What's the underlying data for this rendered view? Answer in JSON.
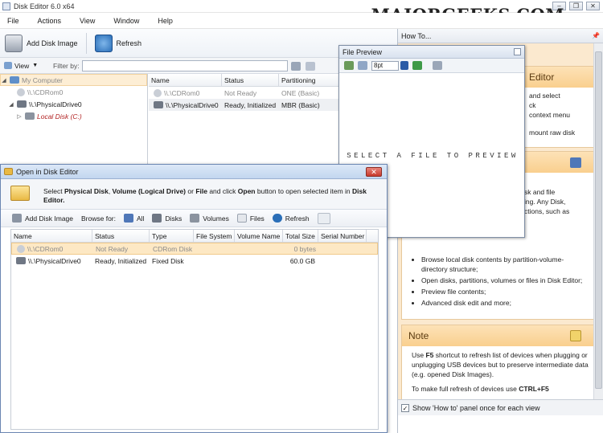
{
  "window": {
    "title": "Disk Editor 6.0 x64",
    "watermark": "MAJORGEEKS.COM",
    "controls": [
      "–",
      "❐",
      "✕"
    ]
  },
  "menu": [
    "File",
    "Actions",
    "View",
    "Window",
    "Help"
  ],
  "toolbar": {
    "add_disk_image": "Add Disk Image",
    "refresh": "Refresh"
  },
  "filterbar": {
    "view_label": "View",
    "filter_label": "Filter by:",
    "filter_value": ""
  },
  "tree": {
    "root": "My Computer",
    "items": [
      {
        "label": "\\\\.\\CDRom0"
      },
      {
        "label": "\\\\.\\PhysicalDrive0"
      },
      {
        "label": "Local Disk (C:)"
      }
    ]
  },
  "grid": {
    "columns": [
      "Name",
      "Status",
      "Partitioning"
    ],
    "rows": [
      {
        "name": "\\\\.\\CDRom0",
        "status": "Not Ready",
        "partitioning": "ONE (Basic)"
      },
      {
        "name": "\\\\.\\PhysicalDrive0",
        "status": "Ready, Initialized",
        "partitioning": "MBR (Basic)"
      }
    ]
  },
  "preview": {
    "title": "File Preview",
    "font_size": "8pt",
    "message": "SELECT A FILE TO PREVIEW"
  },
  "howto": {
    "title": "How To...",
    "section1_heading": "Editor",
    "section1_lines": [
      "and select",
      "ck",
      "context menu",
      "mount raw disk"
    ],
    "section2_lines": [
      "sk and file",
      "ing. Any Disk,",
      "ctions, such as"
    ],
    "bullets": [
      "Browse local disk contents by partition-volume-directory structure;",
      "Open disks, partitions, volumes or files in Disk Editor;",
      "Preview file contents;",
      "Advanced disk edit and more;"
    ],
    "note_heading": "Note",
    "note_p1_pre": "Use ",
    "note_p1_key": "F5",
    "note_p1_post": " shortcut to refresh list of devices when plugging or unplugging USB devices but to preserve intermediate data (e.g. opened Disk Images).",
    "note_p2_pre": "To make full refresh of devices use ",
    "note_p2_key": "CTRL+F5",
    "footer_checkbox": "Show 'How to' panel once for each view"
  },
  "dialog": {
    "title": "Open in Disk Editor",
    "instr_1": "Select ",
    "instr_b1": "Physical Disk",
    "instr_2": ", ",
    "instr_b2": "Volume (Logical Drive)",
    "instr_3": " or ",
    "instr_b3": "File",
    "instr_4": " and click ",
    "instr_b4": "Open",
    "instr_5": " button to open selected item in ",
    "instr_b5": "Disk Editor.",
    "tools": {
      "add_disk_image": "Add Disk Image",
      "browse_for": "Browse for:",
      "all": "All",
      "disks": "Disks",
      "volumes": "Volumes",
      "files": "Files",
      "refresh": "Refresh"
    },
    "columns": [
      "Name",
      "Status",
      "Type",
      "File System",
      "Volume Name",
      "Total Size",
      "Serial Number"
    ],
    "rows": [
      {
        "name": "\\\\.\\CDRom0",
        "status": "Not Ready",
        "type": "CDRom Disk",
        "fs": "",
        "volname": "",
        "size": "0 bytes",
        "serial": ""
      },
      {
        "name": "\\\\.\\PhysicalDrive0",
        "status": "Ready, Initialized",
        "type": "Fixed Disk",
        "fs": "",
        "volname": "",
        "size": "60.0 GB",
        "serial": ""
      }
    ]
  },
  "colors": {
    "accent_orange": "#f9cf8e",
    "panel_bg": "#fbe9cf",
    "selection": "#fde8c4",
    "title_blue": "#c2d6ef"
  }
}
